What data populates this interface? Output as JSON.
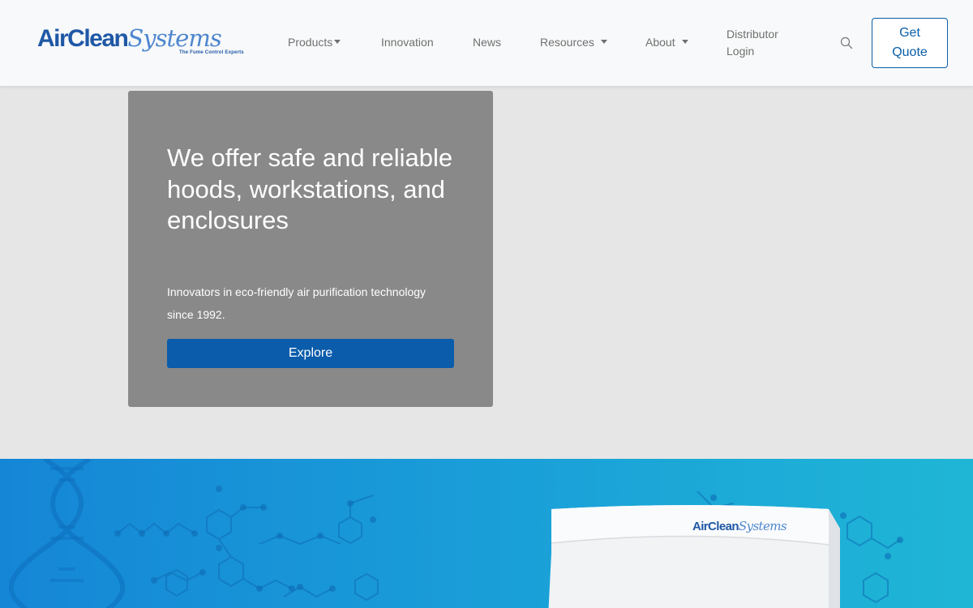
{
  "brand": {
    "name_part1": "AirClean",
    "name_part2": "Systems",
    "tagline": "The Fume Control Experts",
    "primary_color": "#1f58a6",
    "secondary_color": "#4d86cf"
  },
  "nav": {
    "items": [
      {
        "label": "Products",
        "has_dropdown": true
      },
      {
        "label": "Innovation",
        "has_dropdown": false
      },
      {
        "label": "News",
        "has_dropdown": false
      },
      {
        "label": "Resources",
        "has_dropdown": true
      },
      {
        "label": "About",
        "has_dropdown": true
      }
    ],
    "distributor_line1": "Distributor",
    "distributor_line2": "Login",
    "search_icon": "search-icon",
    "quote_line1": "Get",
    "quote_line2": "Quote"
  },
  "hero": {
    "title": "We offer safe and reliable hoods, workstations, and enclosures",
    "subtitle": "Innovators in eco-friendly air purification technology since 1992.",
    "cta": "Explore",
    "card_color": "#898989",
    "cta_color": "#0b5cab"
  },
  "banner": {
    "device_logo_part1": "AirClean",
    "device_logo_part2": "Systems",
    "background_colors": [
      "#1586d6",
      "#1fb6d6"
    ]
  }
}
